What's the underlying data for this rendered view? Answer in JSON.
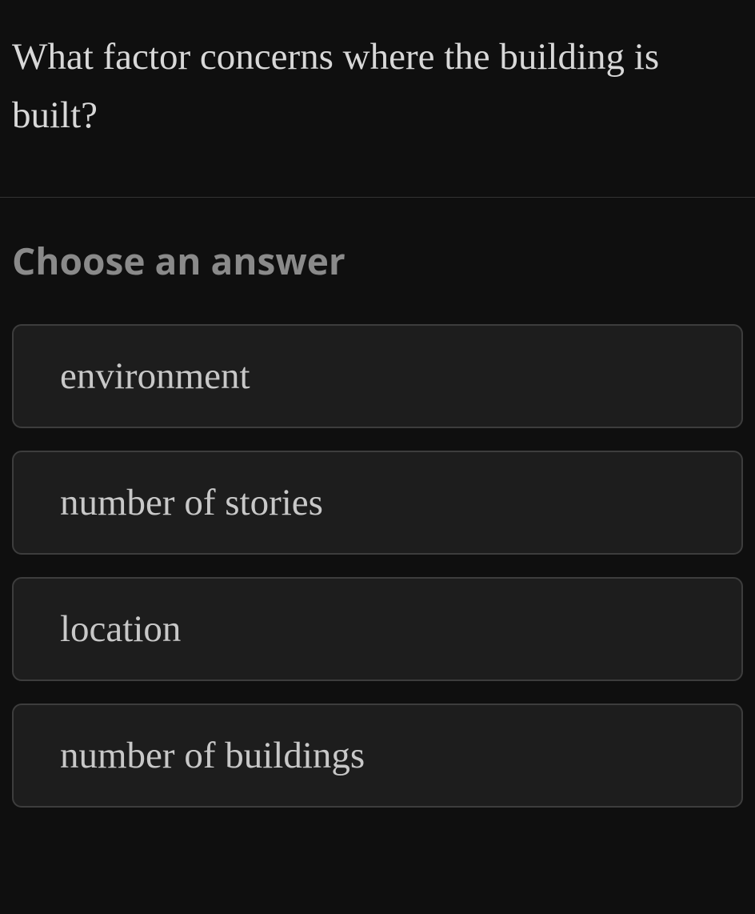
{
  "question": {
    "text": "What factor concerns where the building is built?"
  },
  "prompt": "Choose an answer",
  "options": [
    {
      "label": "environment"
    },
    {
      "label": "number of stories"
    },
    {
      "label": "location"
    },
    {
      "label": "number of buildings"
    }
  ]
}
